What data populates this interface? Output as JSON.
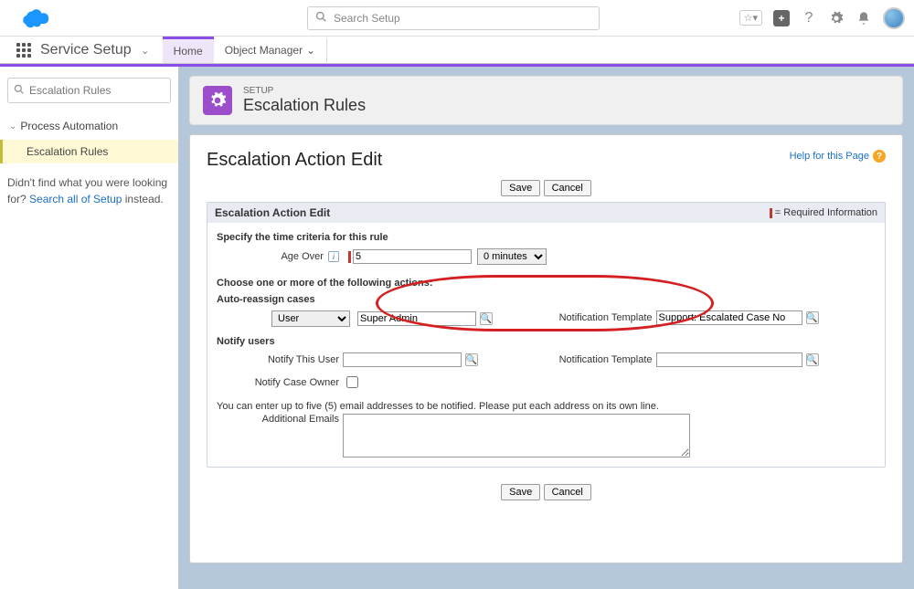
{
  "global": {
    "search_placeholder": "Search Setup"
  },
  "nav": {
    "app_name": "Service Setup",
    "tabs": {
      "home": "Home",
      "object_manager": "Object Manager"
    }
  },
  "sidebar": {
    "search_placeholder": "Escalation Rules",
    "section": "Process Automation",
    "item": "Escalation Rules",
    "help1": "Didn't find what you were looking for? ",
    "help_link": "Search all of Setup",
    "help2": " instead."
  },
  "header": {
    "eyebrow": "SETUP",
    "title": "Escalation Rules"
  },
  "panel": {
    "title": "Escalation Action Edit",
    "help": "Help for this Page",
    "save": "Save",
    "cancel": "Cancel",
    "section_head": "Escalation Action Edit",
    "required": "= Required Information",
    "time_label": "Specify the time criteria for this rule",
    "age_over_label": "Age Over",
    "age_over_value": "5",
    "minutes_label": "0 minutes",
    "choose_actions": "Choose one or more of the following actions:",
    "auto_reassign": "Auto-reassign cases",
    "user_option": "User",
    "user_value": "Super Admin",
    "notif_tpl_label": "Notification Template",
    "notif_tpl_value": "Support: Escalated Case No",
    "notify_users": "Notify users",
    "notify_this_user": "Notify This User",
    "notify_case_owner": "Notify Case Owner",
    "emails_note": "You can enter up to five (5) email addresses to be notified. Please put each address on its own line.",
    "additional_emails": "Additional Emails"
  }
}
